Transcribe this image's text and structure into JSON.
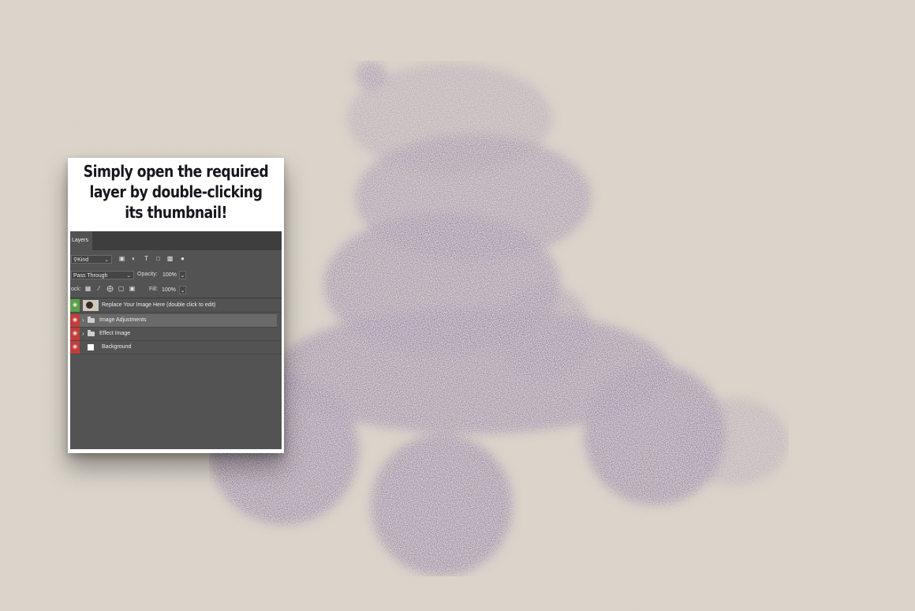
{
  "headline": {
    "line1": "Simply open the required",
    "line2": "layer by double-clicking",
    "line3": "its thumbnail!"
  },
  "layers_panel": {
    "tab_label": "Layers",
    "filter_kind": "Kind",
    "blend_mode": "Pass Through",
    "opacity_label": "Opacity:",
    "opacity_value": "100%",
    "lock_label": "ock:",
    "fill_label": "Fill:",
    "fill_value": "100%",
    "layers": [
      {
        "name": "Replace Your Image Here (double click to edit)",
        "type": "smart-object",
        "visibility_color": "#5aa046"
      },
      {
        "name": "Image Adjustments",
        "type": "group",
        "visibility_color": "#c23d3b",
        "selected": true
      },
      {
        "name": "Effect Image",
        "type": "group",
        "visibility_color": "#c23d3b"
      },
      {
        "name": "Background",
        "type": "fill",
        "visibility_color": "#c23d3b"
      }
    ]
  },
  "colors": {
    "paper": "#dcd6cc",
    "ink": "#4a3566",
    "panel_bg": "#535353"
  }
}
